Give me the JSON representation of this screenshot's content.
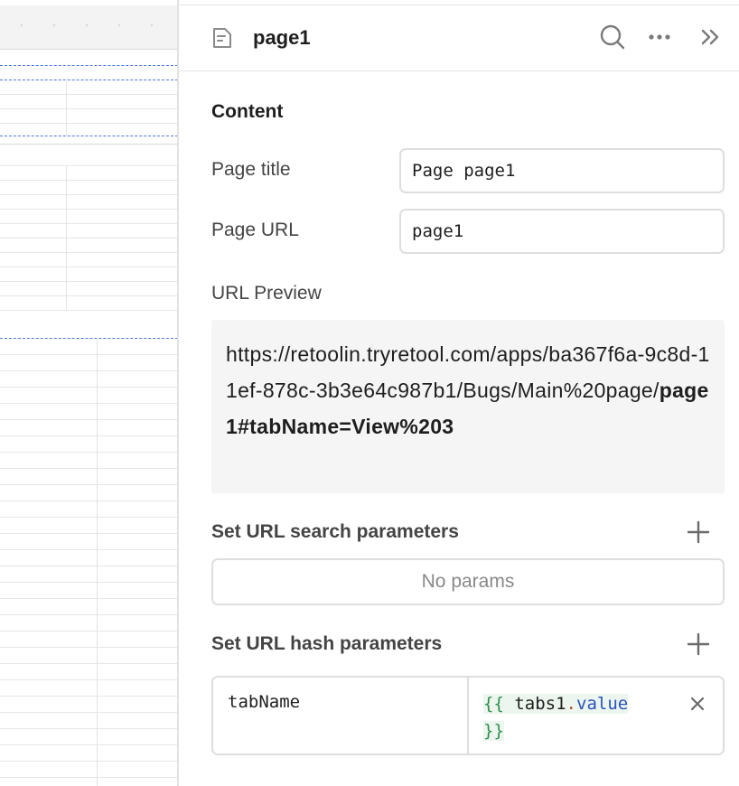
{
  "header": {
    "page_name": "page1",
    "icons": {
      "page": "page-icon",
      "search": "search-icon",
      "more": "more-icon",
      "collapse": "double-chevron-right-icon"
    }
  },
  "content": {
    "section_title": "Content",
    "page_title": {
      "label": "Page title",
      "value": "Page page1"
    },
    "page_url": {
      "label": "Page URL",
      "value": "page1"
    },
    "url_preview": {
      "label": "URL Preview",
      "prefix": "https://retoolin.tryretool.com/apps/ba367f6a-9c8d-11ef-878c-3b3e64c987b1/Bugs/Main%20page/",
      "bold": "page1#tabName=View%203"
    }
  },
  "search_params": {
    "title": "Set URL search parameters",
    "empty_text": "No params"
  },
  "hash_params": {
    "title": "Set URL hash parameters",
    "rows": [
      {
        "key": "tabName",
        "value_open": "{{",
        "value_obj": "tabs1",
        "value_dot": ".",
        "value_prop": "value",
        "value_close": "}}"
      }
    ]
  },
  "colors": {
    "accent_dash": "#4a78e0",
    "template_bg": "#ecf6ee",
    "template_fg": "#2f8f4e"
  }
}
